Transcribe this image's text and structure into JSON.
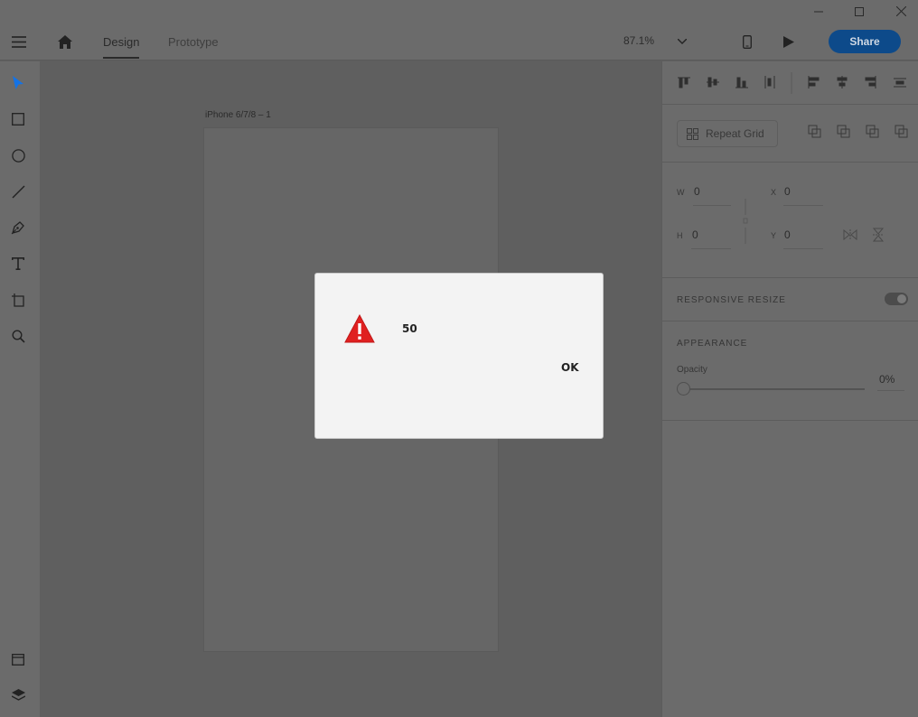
{
  "tabs": {
    "design": "Design",
    "prototype": "Prototype"
  },
  "zoom": {
    "value": "87.1%"
  },
  "share": {
    "label": "Share"
  },
  "artboard": {
    "name": "iPhone 6/7/8 – 1"
  },
  "panel": {
    "repeat_grid": "Repeat Grid",
    "w_label": "W",
    "w_value": "0",
    "h_label": "H",
    "h_value": "0",
    "x_label": "X",
    "x_value": "0",
    "y_label": "Y",
    "y_value": "0",
    "responsive_resize": "RESPONSIVE RESIZE",
    "appearance": "APPEARANCE",
    "opacity_label": "Opacity",
    "opacity_value": "0%"
  },
  "dialog": {
    "message": "50",
    "ok": "OK"
  },
  "colors": {
    "share_bg": "#0d4a8a",
    "select_tool": "#1473e6",
    "warning": "#e02020"
  },
  "icons": [
    "minimize-icon",
    "maximize-icon",
    "close-icon",
    "menu-icon",
    "home-icon",
    "chevron-down-icon",
    "mobile-preview-icon",
    "play-icon",
    "select-tool-icon",
    "rectangle-tool-icon",
    "ellipse-tool-icon",
    "line-tool-icon",
    "pen-tool-icon",
    "text-tool-icon",
    "artboard-tool-icon",
    "zoom-tool-icon",
    "assets-icon",
    "layers-icon",
    "warning-icon"
  ]
}
